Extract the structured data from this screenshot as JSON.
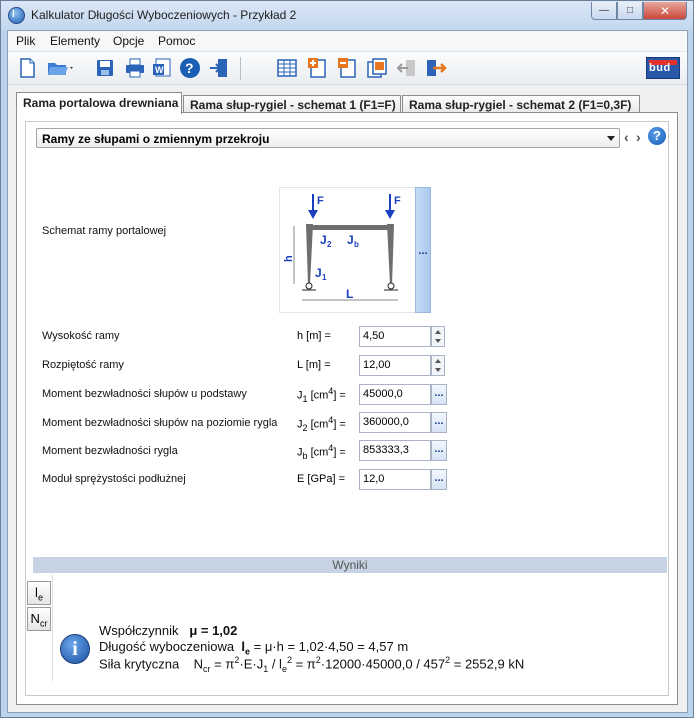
{
  "window": {
    "title": "Kalkulator Długości Wyboczeniowych - Przykład 2",
    "icon_letter": "l"
  },
  "menu": [
    "Plik",
    "Elementy",
    "Opcje",
    "Pomoc"
  ],
  "logo_text": "bud",
  "tabs": [
    "Rama portalowa drewniana",
    "Rama słup-rygiel - schemat 1 (F1=F)",
    "Rama słup-rygiel - schemat 2 (F1=0,3F)"
  ],
  "combo": {
    "value": "Ramy ze słupami o zmiennym przekroju"
  },
  "schema": {
    "label": "Schemat ramy portalowej",
    "F": "F",
    "J2": "J",
    "J2sub": "2",
    "Jb": "J",
    "Jbsub": "b",
    "J1": "J",
    "J1sub": "1",
    "h": "h",
    "L": "L"
  },
  "ellipsis": "...",
  "params": {
    "h": {
      "label": "Wysokość ramy",
      "sym": "h [m] =",
      "value": "4,50"
    },
    "L": {
      "label": "Rozpiętość ramy",
      "sym": "L [m] =",
      "value": "12,00"
    },
    "J1": {
      "label": "Moment bezwładności słupów u podstawy",
      "sym_main": "J",
      "sym_sub": "1",
      "sym_unit": " [cm",
      "sym_exp": "4",
      "sym_end": "] =",
      "value": "45000,0"
    },
    "J2": {
      "label": "Moment bezwładności słupów na poziomie rygla",
      "sym_main": "J",
      "sym_sub": "2",
      "sym_unit": " [cm",
      "sym_exp": "4",
      "sym_end": "] =",
      "value": "360000,0"
    },
    "Jb": {
      "label": "Moment bezwładności rygla",
      "sym_main": "J",
      "sym_sub": "b",
      "sym_unit": " [cm",
      "sym_exp": "4",
      "sym_end": "] =",
      "value": "853333,3"
    },
    "E": {
      "label": "Moduł sprężystości podłużnej",
      "sym": "E [GPa] =",
      "value": "12,0"
    }
  },
  "results": {
    "header": "Wyniki",
    "btn_le": "l",
    "btn_le_sub": "e",
    "btn_ncr": "N",
    "btn_ncr_sub": "cr",
    "coef_label": "Współczynnik",
    "coef_value": "μ = 1,02",
    "len_label": "Długość wyboczeniowa",
    "len_sym": "l",
    "len_sub": "e",
    "len_expr": " = μ·h = 1,02·4,50 = 4,57 m",
    "force_label": "Siła krytyczna",
    "force_sym": "N",
    "force_sub": "cr",
    "force_expr_a": " = π",
    "force_expr_b": "·E·J",
    "force_expr_c": " / l",
    "force_expr_d": " = π",
    "force_expr_e": "·12000·45000,0 / 457",
    "force_expr_f": " = 2552,9 kN",
    "exp2": "2",
    "sub1": "1",
    "sube": "e"
  },
  "colors": {
    "accent": "#1a5fb4",
    "titlebar": "#c3d7ef",
    "results_bar": "#c5d3e3"
  }
}
